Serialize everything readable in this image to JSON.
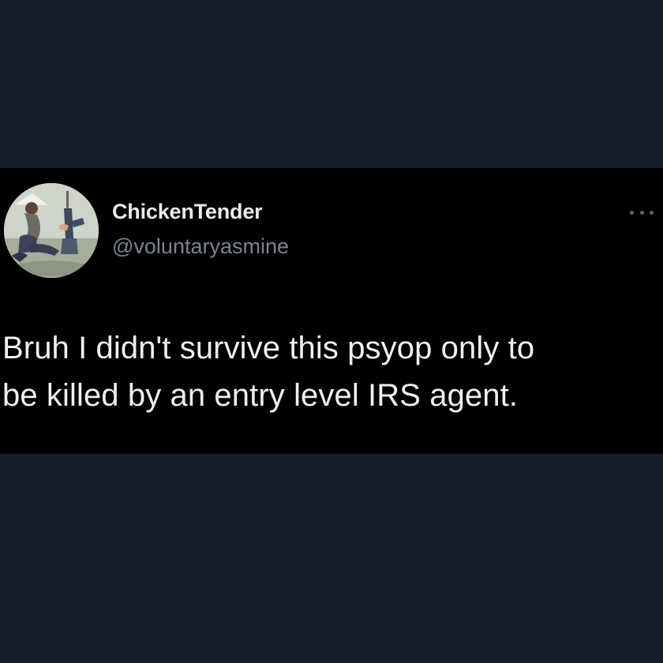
{
  "tweet": {
    "author": {
      "display_name": "ChickenTender",
      "handle": "@voluntaryasmine",
      "avatar_icon": "avatar-photo"
    },
    "more_icon": "more-horizontal-icon",
    "text_lines": [
      "Bruh I didn't survive this psyop only to",
      "be killed by an entry level IRS agent."
    ]
  },
  "colors": {
    "page_background": "#161d2b",
    "card_background": "#000000",
    "name_text": "#e9ebef",
    "handle_text": "#7c848f",
    "body_text": "#eef0f3"
  }
}
